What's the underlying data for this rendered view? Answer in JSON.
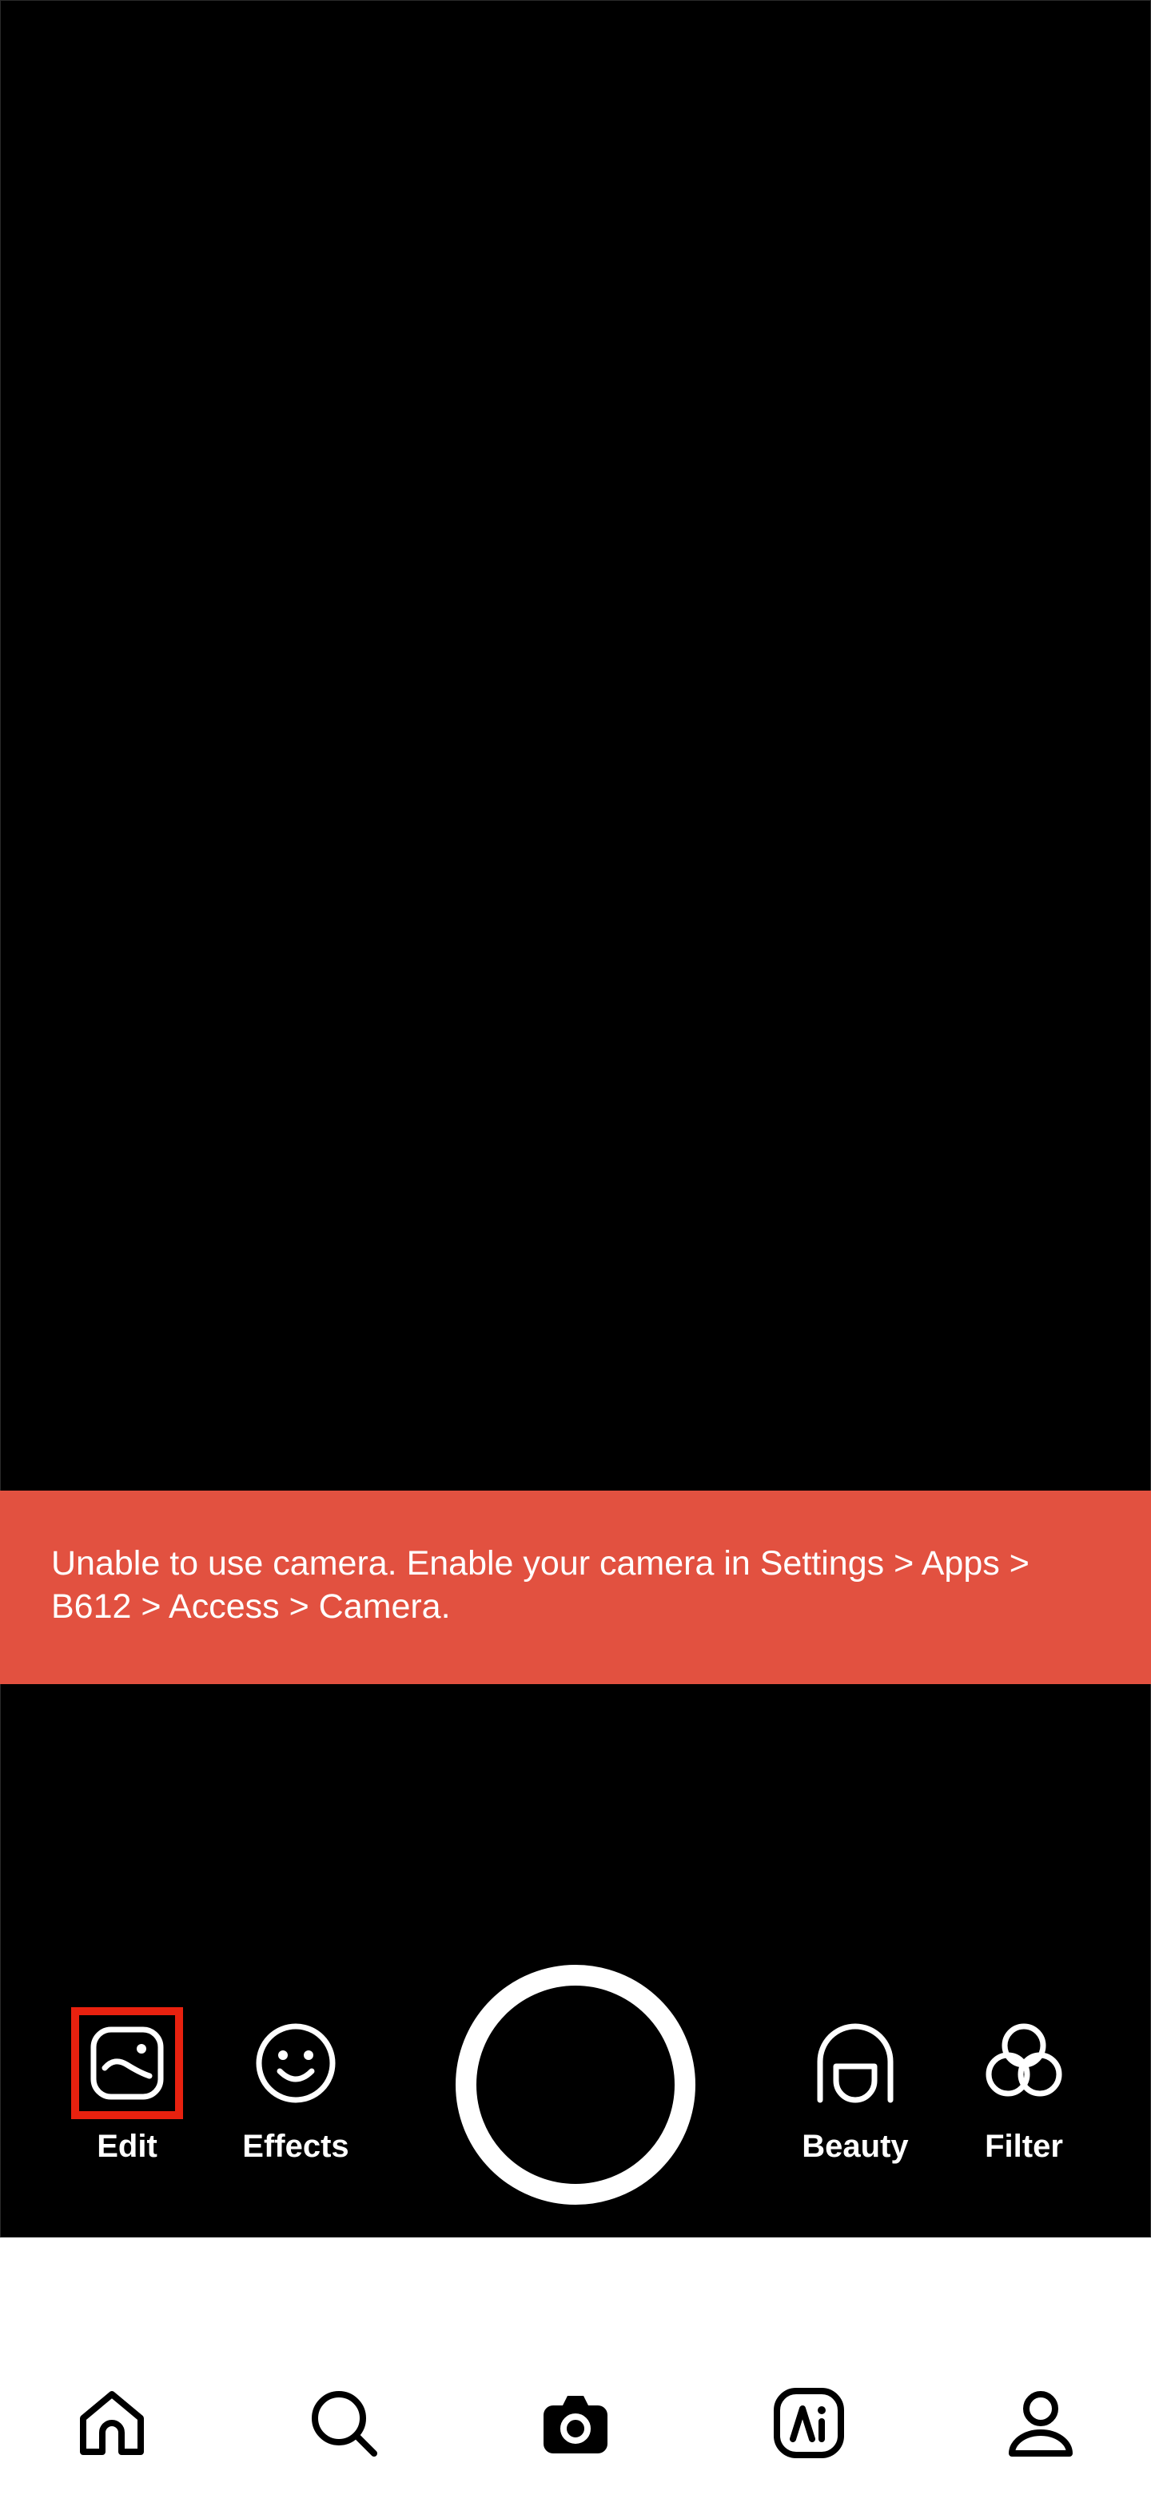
{
  "banner": {
    "message": "Unable to use camera. Enable your camera in Settings > Apps > B612 > Access > Camera."
  },
  "tools": {
    "edit": {
      "label": "Edit",
      "icon": "image-edit-icon",
      "selected": true
    },
    "effects": {
      "label": "Effects",
      "icon": "smiley-icon"
    },
    "beauty": {
      "label": "Beauty",
      "icon": "face-outline-icon"
    },
    "filter": {
      "label": "Filter",
      "icon": "three-circles-icon"
    }
  },
  "nav": {
    "items": [
      {
        "icon": "home-icon"
      },
      {
        "icon": "search-icon"
      },
      {
        "icon": "camera-icon",
        "active": true
      },
      {
        "icon": "ai-icon"
      },
      {
        "icon": "profile-icon"
      }
    ]
  },
  "colors": {
    "banner_bg": "#e25140",
    "highlight": "#e8210f",
    "background": "#000000",
    "navbar_bg": "#ffffff"
  }
}
